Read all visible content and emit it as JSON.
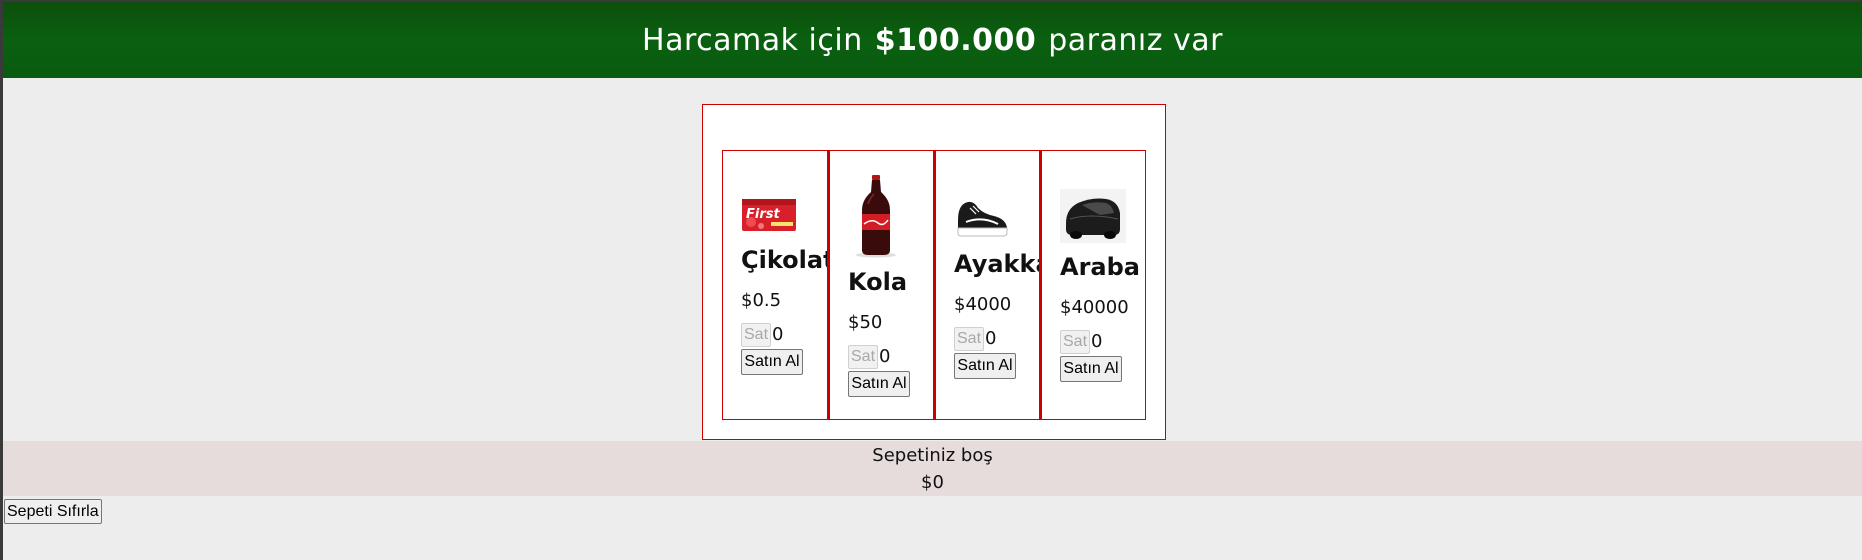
{
  "header": {
    "prefix": "Harcamak için",
    "amount": "$100.000",
    "suffix": "paranız var"
  },
  "products": [
    {
      "image": "chewing-gum-pack-image",
      "name": "Çikolata",
      "price": "$0.5",
      "sell_label": "Sat",
      "quantity": "0",
      "buy_label": "Satın Al"
    },
    {
      "image": "cola-bottle-image",
      "name": "Kola",
      "price": "$50",
      "sell_label": "Sat",
      "quantity": "0",
      "buy_label": "Satın Al"
    },
    {
      "image": "sneaker-shoe-image",
      "name": "Ayakkabı",
      "price": "$4000",
      "sell_label": "Sat",
      "quantity": "0",
      "buy_label": "Satın Al"
    },
    {
      "image": "black-car-image",
      "name": "Araba",
      "price": "$40000",
      "sell_label": "Sat",
      "quantity": "0",
      "buy_label": "Satın Al"
    }
  ],
  "cart": {
    "status": "Sepetiniz boş",
    "total": "$0"
  },
  "reset_label": "Sepeti Sıfırla",
  "colors": {
    "header_bg": "#0a5a10",
    "card_border": "#cc0000",
    "cart_bg": "#e6dcdc"
  }
}
